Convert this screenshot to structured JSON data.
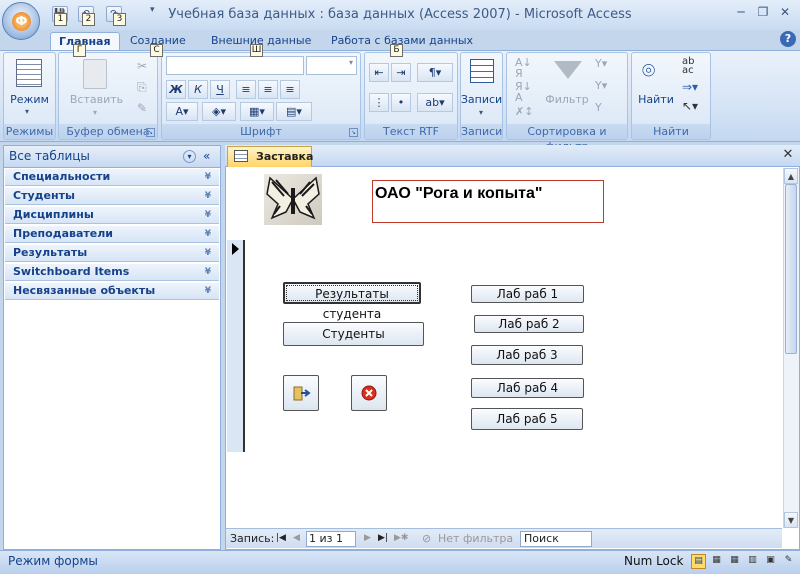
{
  "window": {
    "title": "Учебная база данных : база данных (Access 2007) - Microsoft Access",
    "minimize": "─",
    "restore": "❐",
    "close": "✕"
  },
  "office_button": {
    "glyph": "Ф"
  },
  "quick_access": {
    "keytips": [
      "1",
      "2",
      "3"
    ]
  },
  "ribbon_tabs": [
    {
      "label": "Главная",
      "keytip": "Г"
    },
    {
      "label": "Создание",
      "keytip": "С"
    },
    {
      "label": "Внешние данные",
      "keytip": "Ш"
    },
    {
      "label": "Работа с базами данных",
      "keytip": "Б"
    }
  ],
  "ribbon": {
    "groups": {
      "views": "Режимы",
      "clipboard": "Буфер обмена",
      "font": "Шрифт",
      "rtf": "Текст RTF",
      "records": "Записи",
      "sort": "Сортировка и фильтр",
      "find": "Найти"
    },
    "buttons": {
      "view": "Режим",
      "paste": "Вставить",
      "records": "Записи",
      "filter": "Фильтр",
      "find": "Найти"
    }
  },
  "nav_pane": {
    "header": "Все таблицы",
    "items": [
      "Специальности",
      "Студенты",
      "Дисциплины",
      "Преподаватели",
      "Результаты",
      "Switchboard Items",
      "Несвязанные объекты"
    ]
  },
  "document": {
    "tab_label": "Заставка",
    "form_title": "ОАО \"Рога и копыта\"",
    "buttons_left": [
      "Результаты студента",
      "Студенты"
    ],
    "buttons_right": [
      "Лаб раб 1",
      "Лаб раб 2",
      "Лаб раб 3",
      "Лаб раб 4",
      "Лаб раб 5"
    ]
  },
  "record_nav": {
    "label": "Запись:",
    "position": "1 из 1",
    "filter": "Нет фильтра",
    "search": "Поиск"
  },
  "status": {
    "mode": "Режим формы",
    "numlock": "Num Lock"
  },
  "colors": {
    "accent": "#15428b",
    "ribbon": "#d2e2f5",
    "form_title_border": "#c0392b"
  }
}
